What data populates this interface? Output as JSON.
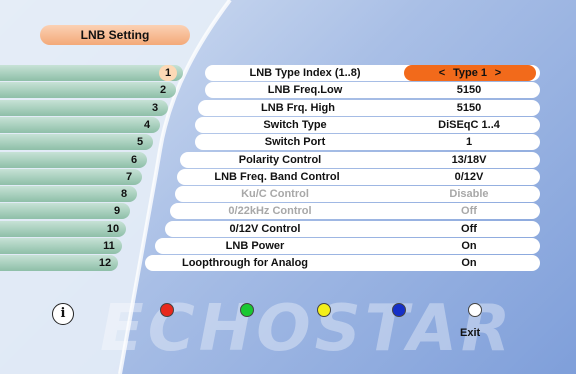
{
  "title": "LNB Setting",
  "rows": [
    {
      "num": "1",
      "label": "LNB Type Index (1..8)",
      "value": "Type 1",
      "selected": true,
      "disabled": false
    },
    {
      "num": "2",
      "label": "LNB Freq.Low",
      "value": "5150",
      "selected": false,
      "disabled": false
    },
    {
      "num": "3",
      "label": "LNB Frq. High",
      "value": "5150",
      "selected": false,
      "disabled": false
    },
    {
      "num": "4",
      "label": "Switch Type",
      "value": "DiSEqC 1..4",
      "selected": false,
      "disabled": false
    },
    {
      "num": "5",
      "label": "Switch Port",
      "value": "1",
      "selected": false,
      "disabled": false
    },
    {
      "num": "6",
      "label": "Polarity Control",
      "value": "13/18V",
      "selected": false,
      "disabled": false
    },
    {
      "num": "7",
      "label": "LNB Freq. Band Control",
      "value": "0/12V",
      "selected": false,
      "disabled": false
    },
    {
      "num": "8",
      "label": "Ku/C Control",
      "value": "Disable",
      "selected": false,
      "disabled": true
    },
    {
      "num": "9",
      "label": "0/22kHz Control",
      "value": "Off",
      "selected": false,
      "disabled": true
    },
    {
      "num": "10",
      "label": "0/12V Control",
      "value": "Off",
      "selected": false,
      "disabled": false
    },
    {
      "num": "11",
      "label": "LNB Power",
      "value": "On",
      "selected": false,
      "disabled": false
    },
    {
      "num": "12",
      "label": "Loopthrough for Analog",
      "value": "On",
      "selected": false,
      "disabled": false
    }
  ],
  "arrow_left": "<",
  "arrow_right": ">",
  "info_icon_text": "i",
  "color_buttons": [
    {
      "name": "red-button",
      "color": "#e8281c"
    },
    {
      "name": "green-button",
      "color": "#19c832"
    },
    {
      "name": "yellow-button",
      "color": "#f4ef1a"
    },
    {
      "name": "blue-button",
      "color": "#1530c8"
    },
    {
      "name": "white-button",
      "color": "#ffffff"
    }
  ],
  "exit_label": "Exit",
  "watermark": "ECHOSTAR"
}
